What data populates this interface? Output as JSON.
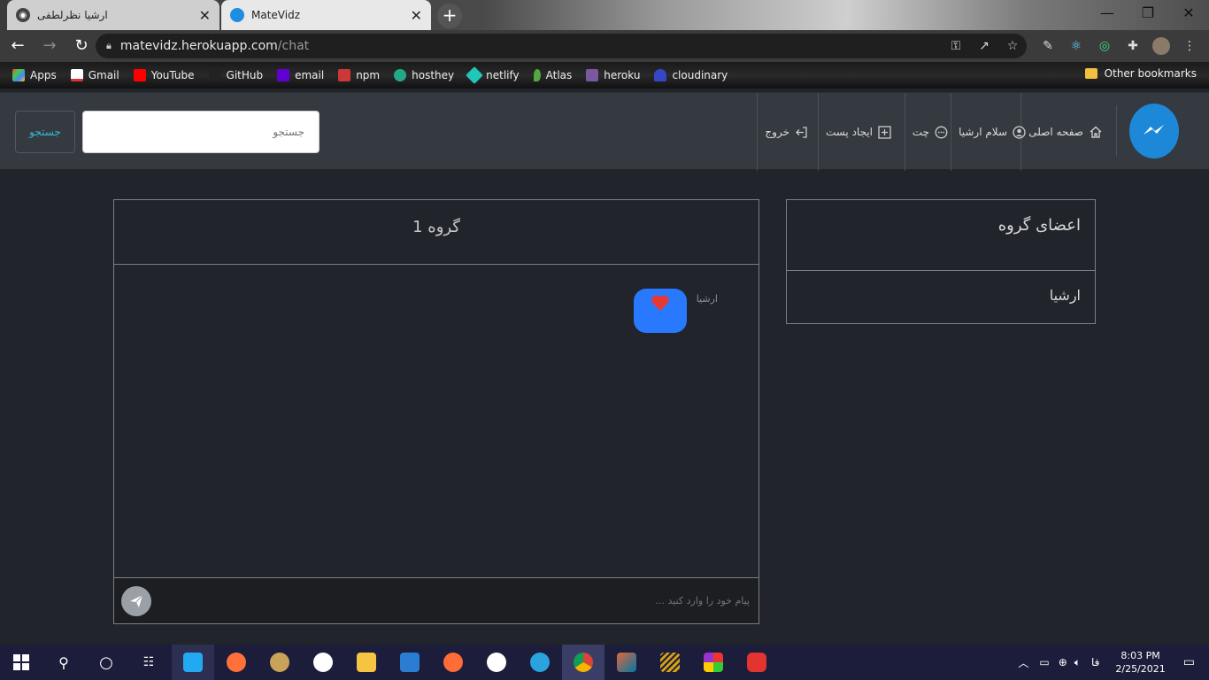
{
  "browser": {
    "tabs": [
      {
        "title": "ارشیا نظرلطفی"
      },
      {
        "title": "MateVidz"
      }
    ],
    "url_host": "matevidz.herokuapp.com",
    "url_path": "/chat",
    "bookmarks": [
      "Apps",
      "Gmail",
      "YouTube",
      "GitHub",
      "email",
      "npm",
      "hosthey",
      "netlify",
      "Atlas",
      "heroku",
      "cloudinary"
    ],
    "other_bookmarks": "Other bookmarks"
  },
  "navbar": {
    "home": "صفحه اصلی",
    "greeting": "سلام ارشیا",
    "chat": "چت",
    "create_post": "ایجاد پست",
    "logout": "خروج",
    "search_placeholder": "جستجو",
    "search_button": "جستجو"
  },
  "members_panel": {
    "title": "اعضای گروه",
    "members": [
      "ارشیا"
    ]
  },
  "chat": {
    "title": "گروه 1",
    "messages": [
      {
        "sender": "ارشیا",
        "content": "heart"
      }
    ],
    "input_placeholder": "پیام خود را وارد کنید ..."
  },
  "taskbar": {
    "time": "8:03 PM",
    "date": "2/25/2021",
    "lang": "فا"
  },
  "colors": {
    "page_bg": "#21242b",
    "navbar_bg": "#343a40",
    "bubble": "#2979ff",
    "heart": "#e53935",
    "search_button_text": "#38b7d8"
  }
}
